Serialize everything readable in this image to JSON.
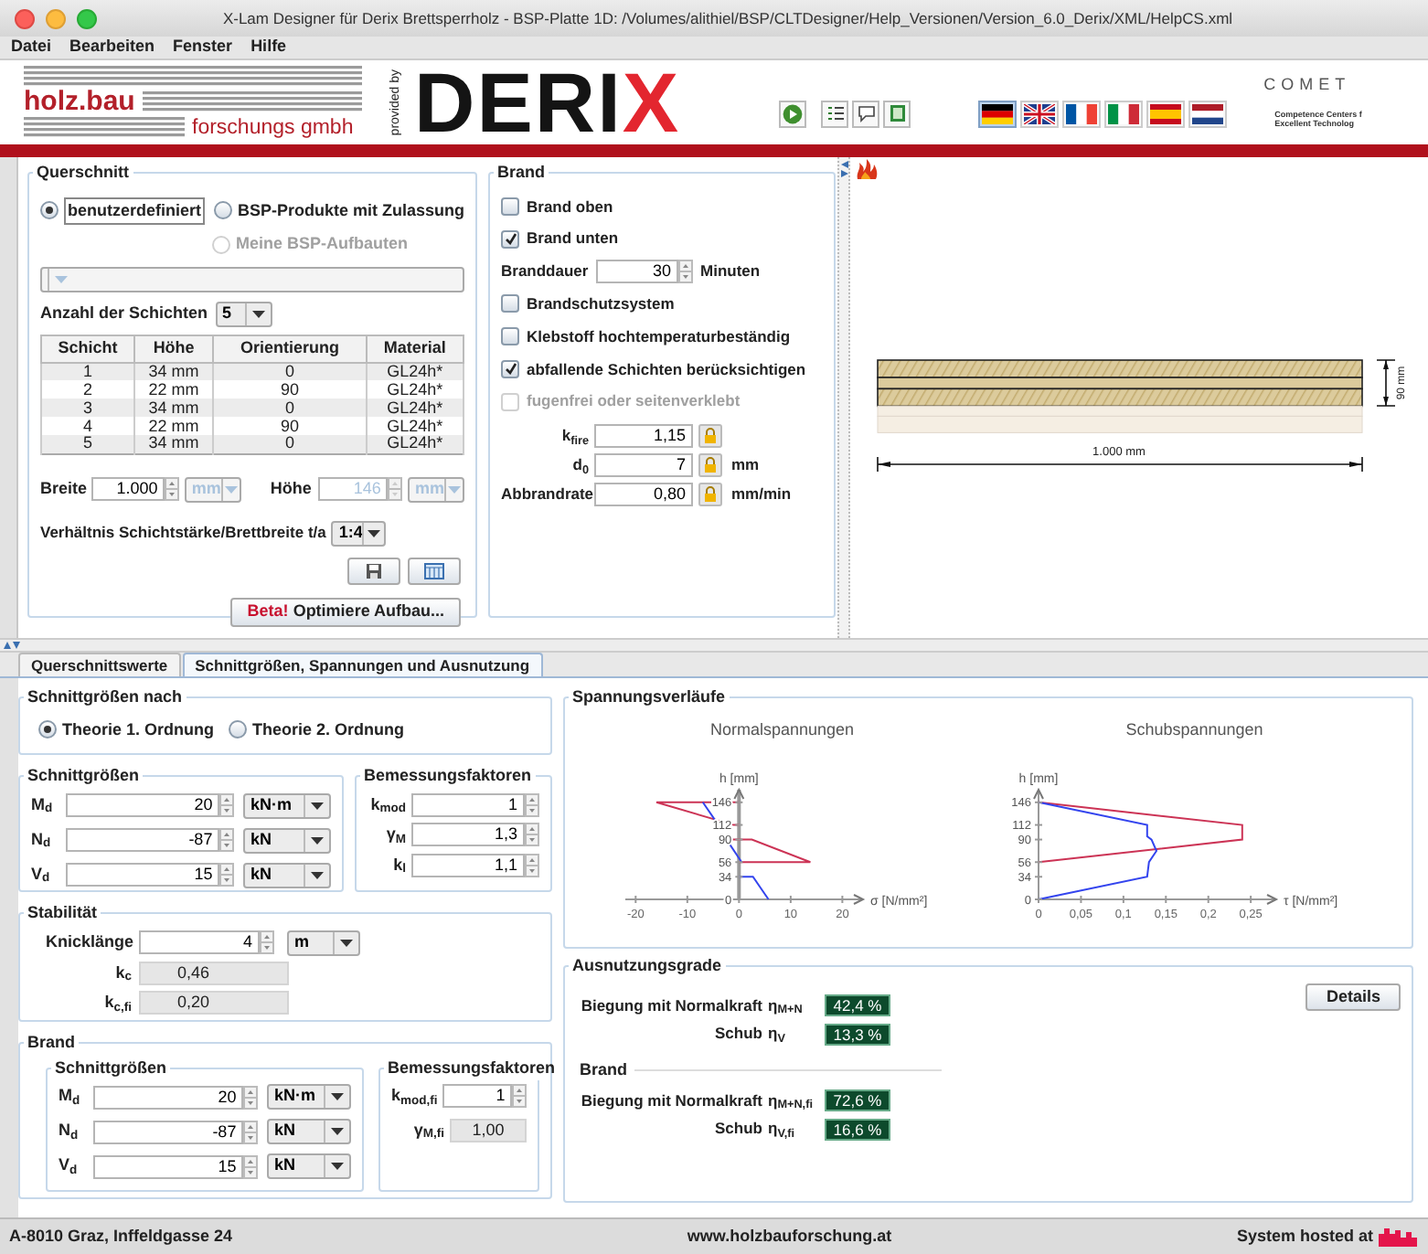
{
  "window": {
    "title": "X-Lam Designer für Derix Brettsperrholz - BSP-Platte 1D: /Volumes/alithiel/BSP/CLTDesigner/Help_Versionen/Version_6.0_Derix/XML/HelpCS.xml"
  },
  "menu": [
    "Datei",
    "Bearbeiten",
    "Fenster",
    "Hilfe"
  ],
  "header": {
    "holzbau_logo": {
      "line_1": "holz.bau",
      "line_2": "forschungs gmbh"
    },
    "provided_by": "provided by",
    "derix_logo": {
      "text": "DERI",
      "accent": "X"
    },
    "flags": [
      {
        "kind": "de",
        "selected": true
      },
      {
        "kind": "gb",
        "selected": false
      },
      {
        "kind": "fr",
        "selected": false
      },
      {
        "kind": "it",
        "selected": false
      },
      {
        "kind": "es",
        "selected": false
      },
      {
        "kind": "nl",
        "selected": false
      }
    ],
    "comet_logo": {
      "text": "COMET",
      "line_1": "Competence Centers f",
      "line_2": "Excellent Technolog"
    }
  },
  "querschnitt": {
    "title": "Querschnitt",
    "radios": [
      {
        "label": "benutzerdefiniert",
        "selected": true,
        "disabled": false
      },
      {
        "label": "BSP-Produkte mit Zulassung",
        "selected": false,
        "disabled": false
      },
      {
        "label": "Meine BSP-Aufbauten",
        "selected": false,
        "disabled": true
      }
    ],
    "product_select": {
      "disabled": true
    },
    "layer_count": {
      "label": "Anzahl der Schichten",
      "value": "5"
    },
    "table": {
      "columns": [
        "Schicht",
        "Höhe",
        "Orientierung",
        "Material"
      ],
      "rows": [
        [
          "1",
          "34 mm",
          "0",
          "GL24h*"
        ],
        [
          "2",
          "22 mm",
          "90",
          "GL24h*"
        ],
        [
          "3",
          "34 mm",
          "0",
          "GL24h*"
        ],
        [
          "4",
          "22 mm",
          "90",
          "GL24h*"
        ],
        [
          "5",
          "34 mm",
          "0",
          "GL24h*"
        ]
      ]
    },
    "width": {
      "label": "Breite",
      "value": "1.000",
      "unit": "mm",
      "disabled": false,
      "unit_disabled": true
    },
    "height": {
      "label": "Höhe",
      "value": "146",
      "unit": "mm",
      "disabled": true,
      "unit_disabled": true
    },
    "ratio": {
      "label": "Verhältnis Schichtstärke/Brettbreite t/a",
      "value": "1:4"
    },
    "optimize_button": {
      "accent": "Beta!",
      "label": "Optimiere Aufbau..."
    }
  },
  "brand": {
    "title": "Brand",
    "items": [
      {
        "kind": "checkbox",
        "label": "Brand oben",
        "checked": false,
        "disabled": false
      },
      {
        "kind": "checkbox",
        "label": "Brand unten",
        "checked": true,
        "disabled": false
      },
      {
        "kind": "spinner",
        "label": "Branddauer",
        "value": "30",
        "unit": "Minuten"
      },
      {
        "kind": "checkbox",
        "label": "Brandschutzsystem",
        "checked": false,
        "disabled": false
      },
      {
        "kind": "checkbox",
        "label": "Klebstoff hochtemperaturbeständig",
        "checked": false,
        "disabled": false
      },
      {
        "kind": "checkbox",
        "label": "abfallende Schichten berücksichtigen",
        "checked": true,
        "disabled": false
      },
      {
        "kind": "checkbox",
        "label": "fugenfrei oder seitenverklebt",
        "checked": false,
        "disabled": true
      }
    ],
    "params": [
      {
        "label": "k$_{fire}$",
        "value": "1,15"
      },
      {
        "label": "d$_{0}$",
        "value": "7",
        "unit": "mm"
      },
      {
        "label": "Abbrandrate",
        "value": "0,80",
        "unit": "mm/min"
      }
    ]
  },
  "drawing": {
    "width_label": "1.000 mm",
    "height_label": "90 mm"
  },
  "tabs": [
    {
      "label": "Querschnittswerte",
      "selected": false
    },
    {
      "label": "Schnittgrößen, Spannungen und Ausnutzung",
      "selected": true
    }
  ],
  "theory": {
    "title": "Schnittgrößen nach",
    "radios": [
      {
        "label": "Theorie 1. Ordnung",
        "selected": true
      },
      {
        "label": "Theorie 2. Ordnung",
        "selected": false
      }
    ]
  },
  "forces": {
    "title": "Schnittgrößen",
    "rows": [
      {
        "symbol": "M$_{d}$",
        "value": "20",
        "unit": "kN·m"
      },
      {
        "symbol": "N$_{d}$",
        "value": "-87",
        "unit": "kN"
      },
      {
        "symbol": "V$_{d}$",
        "value": "15",
        "unit": "kN"
      }
    ]
  },
  "factors": {
    "title": "Bemessungsfaktoren",
    "rows": [
      {
        "symbol": "k$_{mod}$",
        "value": "1"
      },
      {
        "symbol": "γ$_{M}$",
        "value": "1,3"
      },
      {
        "symbol": "k$_{l}$",
        "value": "1,1"
      }
    ]
  },
  "stability": {
    "title": "Stabilität",
    "buckling": {
      "label": "Knicklänge",
      "value": "4",
      "unit": "m"
    },
    "readouts": [
      {
        "symbol": "k$_{c}$",
        "value": "0,46"
      },
      {
        "symbol": "k$_{c,fi}$",
        "value": "0,20"
      }
    ]
  },
  "fire": {
    "title": "Brand",
    "forces": {
      "title": "Schnittgrößen",
      "rows": [
        {
          "symbol": "M$_{d}$",
          "value": "20",
          "unit": "kN·m"
        },
        {
          "symbol": "N$_{d}$",
          "value": "-87",
          "unit": "kN"
        },
        {
          "symbol": "V$_{d}$",
          "value": "15",
          "unit": "kN"
        }
      ]
    },
    "factors": {
      "title": "Bemessungsfaktoren",
      "rows": [
        {
          "kind": "spinner",
          "symbol": "k$_{mod,fi}$",
          "value": "1"
        },
        {
          "kind": "readout",
          "symbol": "γ$_{M,fi}$",
          "value": "1,00"
        }
      ]
    }
  },
  "stress": {
    "title": "Spannungsverläufe",
    "charts": [
      {
        "chart_data": {
          "type": "line",
          "title": "Normalspannungen",
          "xlabel": "σ [N/mm²]",
          "ylabel": "h [mm]",
          "xlim": [
            -22,
            24
          ],
          "ylim": [
            0,
            165
          ],
          "xticks": [
            {
              "value": -20,
              "label": "-20"
            },
            {
              "value": -10,
              "label": "-10"
            },
            {
              "value": 0,
              "label": "0"
            },
            {
              "value": 10,
              "label": "10"
            },
            {
              "value": 20,
              "label": "20"
            }
          ],
          "yticks": [
            {
              "value": 0,
              "label": "0"
            },
            {
              "value": 34,
              "label": "34"
            },
            {
              "value": 56,
              "label": "56"
            },
            {
              "value": 90,
              "label": "90"
            },
            {
              "value": 112,
              "label": "112"
            },
            {
              "value": 146,
              "label": "146"
            }
          ],
          "series": [
            {
              "color": "#cc3355",
              "x": [
                0,
                -16,
                -1,
                0,
                null,
                -2,
                2.5,
                13.8,
                0
              ],
              "values": [
                146,
                146,
                112,
                112,
                null,
                90,
                90,
                56,
                56
              ]
            },
            {
              "color": "#3344ee",
              "x": [
                -7,
                -4,
                null,
                -2.4,
                0.5,
                null,
                0,
                2.7,
                5.7
              ],
              "values": [
                146,
                112,
                null,
                90,
                56,
                null,
                34,
                34,
                0
              ]
            }
          ]
        }
      },
      {
        "chart_data": {
          "type": "line",
          "title": "Schubspannungen",
          "xlabel": "τ [N/mm²]",
          "ylabel": "h [mm]",
          "xlim": [
            0,
            0.28
          ],
          "ylim": [
            0,
            165
          ],
          "xticks": [
            {
              "value": 0,
              "label": "0"
            },
            {
              "value": 0.05,
              "label": "0,05"
            },
            {
              "value": 0.1,
              "label": "0,1"
            },
            {
              "value": 0.15,
              "label": "0,15"
            },
            {
              "value": 0.2,
              "label": "0,2"
            },
            {
              "value": 0.25,
              "label": "0,25"
            }
          ],
          "yticks": [
            {
              "value": 0,
              "label": "0"
            },
            {
              "value": 34,
              "label": "34"
            },
            {
              "value": 56,
              "label": "56"
            },
            {
              "value": 90,
              "label": "90"
            },
            {
              "value": 112,
              "label": "112"
            },
            {
              "value": 146,
              "label": "146"
            }
          ],
          "series": [
            {
              "color": "#cc3355",
              "x": [
                0,
                0.24,
                0.24,
                0
              ],
              "values": [
                146,
                112,
                90,
                56
              ]
            },
            {
              "color": "#3344ee",
              "x": [
                0,
                0.128,
                0.128,
                0.133,
                0.139,
                0.13,
                0.128,
                0
              ],
              "values": [
                146,
                112,
                95,
                90,
                73,
                56,
                34,
                0
              ]
            }
          ]
        }
      }
    ]
  },
  "utilization": {
    "title": "Ausnutzungsgrade",
    "button": "Details",
    "groups": [
      {
        "rows": [
          {
            "label": "Biegung mit Normalkraft",
            "symbol": "η$_{M+N}$",
            "value": "42,4 %"
          },
          {
            "label": "Schub",
            "symbol": "η$_{V}$",
            "value": "13,3 %"
          }
        ]
      },
      {
        "title": "Brand",
        "rows": [
          {
            "label": "Biegung mit Normalkraft",
            "symbol": "η$_{M+N,fi}$",
            "value": "72,6 %"
          },
          {
            "label": "Schub",
            "symbol": "η$_{V,fi}$",
            "value": "16,6 %"
          }
        ]
      }
    ]
  },
  "status_bar": {
    "address": "A-8010 Graz, Inffeldgasse 24",
    "website": "www.holzbauforschung.at",
    "hosted": "System hosted at"
  }
}
